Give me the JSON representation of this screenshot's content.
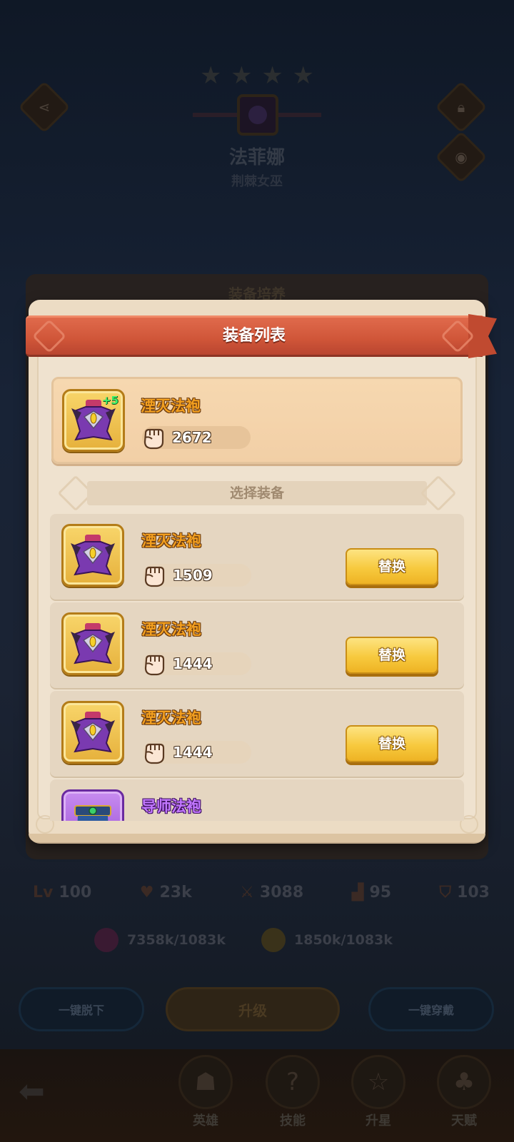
{
  "background": {
    "star_count": 4,
    "hero_name": "法菲娜",
    "hero_title": "荆棘女巫",
    "behind_title": "装备培养",
    "stats": [
      {
        "icon": "level-icon",
        "prefix": "Lv",
        "value": "100"
      },
      {
        "icon": "heart-icon",
        "value": "23k"
      },
      {
        "icon": "sword-icon",
        "value": "3088"
      },
      {
        "icon": "boot-icon",
        "value": "95"
      },
      {
        "icon": "shield-icon",
        "value": "103"
      }
    ],
    "resources": [
      {
        "icon": "purple-gem-icon",
        "value": "7358k/1083k"
      },
      {
        "icon": "gold-coin-icon",
        "value": "1850k/1083k"
      }
    ],
    "buttons": {
      "unequip_all": "一键脱下",
      "upgrade": "升级",
      "equip_all": "一键穿戴"
    },
    "nav": [
      {
        "icon": "hero-icon",
        "label": "英雄"
      },
      {
        "icon": "skill-icon",
        "label": "技能"
      },
      {
        "icon": "star-up-icon",
        "label": "升星"
      },
      {
        "icon": "talent-icon",
        "label": "天赋"
      }
    ]
  },
  "modal": {
    "title": "装备列表",
    "equipped": {
      "name": "湮灭法袍",
      "enhance": "+5",
      "power": "2672",
      "rarity_color": "#f3a020"
    },
    "section_label": "选择装备",
    "items": [
      {
        "name": "湮灭法袍",
        "power": "1509",
        "button": "替换",
        "rarity": "gold"
      },
      {
        "name": "湮灭法袍",
        "power": "1444",
        "button": "替换",
        "rarity": "gold"
      },
      {
        "name": "湮灭法袍",
        "power": "1444",
        "button": "替换",
        "rarity": "gold"
      },
      {
        "name": "导师法袍",
        "power": "",
        "button": "",
        "rarity": "purple"
      }
    ]
  },
  "colors": {
    "ribbon": "#cf5538",
    "gold_button": "#f7c93e",
    "panel": "#ecdcc4"
  }
}
